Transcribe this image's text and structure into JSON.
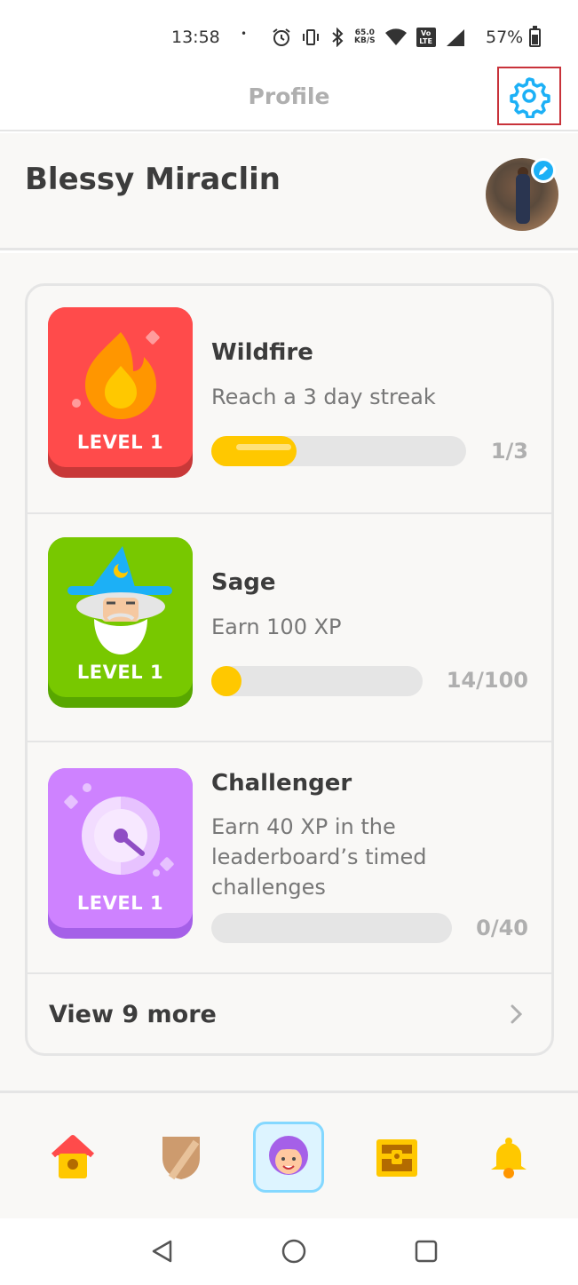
{
  "status_bar": {
    "time": "13:58",
    "dot": "•",
    "net_speed_value": "65.0",
    "net_speed_unit": "KB/S",
    "volte": "Vo LTE",
    "battery_pct": "57%"
  },
  "header": {
    "title": "Profile",
    "settings_icon": "gear-icon"
  },
  "profile": {
    "name": "Blessy Miraclin",
    "avatar_icon": "avatar-photo",
    "edit_icon": "pencil-icon"
  },
  "achievements": [
    {
      "title": "Wildfire",
      "description": "Reach a 3 day streak",
      "level": "LEVEL 1",
      "progress_text": "1/3",
      "progress": 0.333,
      "badge_color": "#ff4b4b",
      "icon": "flame-icon"
    },
    {
      "title": "Sage",
      "description": "Earn 100 XP",
      "level": "LEVEL 1",
      "progress_text": "14/100",
      "progress": 0.14,
      "badge_color": "#78c800",
      "icon": "wizard-icon"
    },
    {
      "title": "Challenger",
      "description": "Earn 40 XP in the leaderboard’s timed challenges",
      "level": "LEVEL 1",
      "progress_text": "0/40",
      "progress": 0,
      "badge_color": "#ce82ff",
      "icon": "timer-icon"
    }
  ],
  "view_more": {
    "label": "View 9 more",
    "icon": "chevron-right-icon"
  },
  "bottom_nav": [
    {
      "name": "home",
      "icon": "home-icon",
      "active": false
    },
    {
      "name": "leagues",
      "icon": "shield-icon",
      "active": false
    },
    {
      "name": "profile",
      "icon": "profile-avatar-icon",
      "active": true
    },
    {
      "name": "shop",
      "icon": "treasure-chest-icon",
      "active": false
    },
    {
      "name": "notifications",
      "icon": "bell-icon",
      "active": false
    }
  ],
  "colors": {
    "accent_blue": "#1cb0f6",
    "progress_yellow": "#ffc800",
    "settings_highlight": "#c8323a"
  }
}
